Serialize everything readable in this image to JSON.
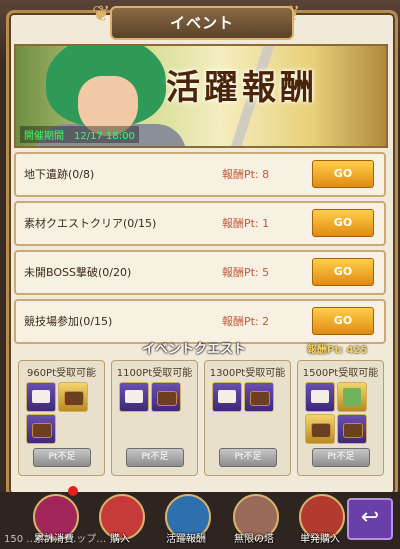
{
  "header": {
    "title": "イベント"
  },
  "banner": {
    "title": "活躍報酬",
    "period": "開催期間　12/17 18:00"
  },
  "missions": [
    {
      "name": "地下遺跡(0/8)",
      "points": "報酬Pt: 8",
      "button": "GO"
    },
    {
      "name": "素材クエストクリア(0/15)",
      "points": "報酬Pt: 1",
      "button": "GO"
    },
    {
      "name": "未開BOSS撃破(0/20)",
      "points": "報酬Pt: 5",
      "button": "GO"
    },
    {
      "name": "競技場参加(0/15)",
      "points": "報酬Pt: 2",
      "button": "GO"
    }
  ],
  "quest": {
    "title": "イベントクエスト",
    "total_points": "報酬Pt: 425"
  },
  "rewards": [
    {
      "label": "960Pt受取可能",
      "button": "Pt不足",
      "icons": [
        "envelope-icon",
        "chest-icon",
        "chest-icon"
      ]
    },
    {
      "label": "1100Pt受取可能",
      "button": "Pt不足",
      "icons": [
        "envelope-icon",
        "chest-icon"
      ]
    },
    {
      "label": "1300Pt受取可能",
      "button": "Pt不足",
      "icons": [
        "envelope-icon",
        "chest-icon"
      ]
    },
    {
      "label": "1500Pt受取可能",
      "button": "Pt不足",
      "icons": [
        "envelope-icon",
        "green-item-icon",
        "chest-icon",
        "chest-icon"
      ]
    }
  ],
  "nav": [
    {
      "label": "累計消費",
      "color": "#a3265a"
    },
    {
      "label": "購入",
      "color": "#c63a3a"
    },
    {
      "label": "活躍報酬",
      "color": "#2e6fae"
    },
    {
      "label": "無限の塔",
      "color": "#9a6a5a"
    },
    {
      "label": "単発購入",
      "color": "#b23a2e"
    }
  ],
  "back": {
    "icon": "back-arrow-icon",
    "glyph": "↩"
  },
  "ticker": "150 …ヘルト…ップ…"
}
